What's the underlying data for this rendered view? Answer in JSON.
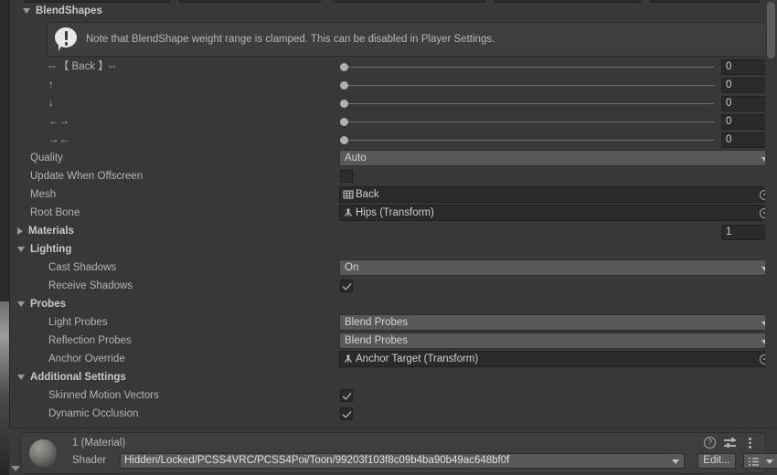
{
  "blendshapes": {
    "section_label": "BlendShapes",
    "info_message": "Note that BlendShape weight range is clamped. This can be disabled in Player Settings.",
    "info_icon": "warning-icon",
    "shapes": [
      {
        "label": "-- 【 Back 】--",
        "value": "0"
      },
      {
        "label": "↑",
        "value": "0"
      },
      {
        "label": "↓",
        "value": "0"
      },
      {
        "label": "←→",
        "value": "0"
      },
      {
        "label": "→←",
        "value": "0"
      }
    ]
  },
  "renderer": {
    "quality": {
      "label": "Quality",
      "value": "Auto"
    },
    "update_when_offscreen": {
      "label": "Update When Offscreen",
      "checked": false
    },
    "mesh": {
      "label": "Mesh",
      "value": "Back",
      "icon": "mesh-icon"
    },
    "root_bone": {
      "label": "Root Bone",
      "value": "Hips (Transform)",
      "icon": "transform-icon"
    },
    "materials": {
      "label": "Materials",
      "count": "1"
    }
  },
  "lighting": {
    "section_label": "Lighting",
    "cast_shadows": {
      "label": "Cast Shadows",
      "value": "On"
    },
    "receive_shadows": {
      "label": "Receive Shadows",
      "checked": true
    }
  },
  "probes": {
    "section_label": "Probes",
    "light_probes": {
      "label": "Light Probes",
      "value": "Blend Probes"
    },
    "reflection_probes": {
      "label": "Reflection Probes",
      "value": "Blend Probes"
    },
    "anchor_override": {
      "label": "Anchor Override",
      "value": "Anchor Target (Transform)",
      "icon": "transform-icon"
    }
  },
  "additional_settings": {
    "section_label": "Additional Settings",
    "skinned_motion_vectors": {
      "label": "Skinned Motion Vectors",
      "checked": true
    },
    "dynamic_occlusion": {
      "label": "Dynamic Occlusion",
      "checked": true
    }
  },
  "material_footer": {
    "title": "1 (Material)",
    "shader_label": "Shader",
    "shader_value": "Hidden/Locked/PCSS4VRC/PCSS4Poi/Toon/99203f103f8c09b4ba90b49ac648bf0f",
    "edit_button": "Edit...",
    "help_icon": "help-icon",
    "preset_icon": "preset-sliders-icon",
    "menu_icon": "kebab-menu-icon",
    "preview_icon": "material-sphere-preview"
  },
  "colors": {
    "panel_bg": "#383838",
    "field_bg": "#2a2a2a",
    "popup_bg": "#585858",
    "text": "#b4b4b4",
    "heading": "#c9c9c9"
  }
}
